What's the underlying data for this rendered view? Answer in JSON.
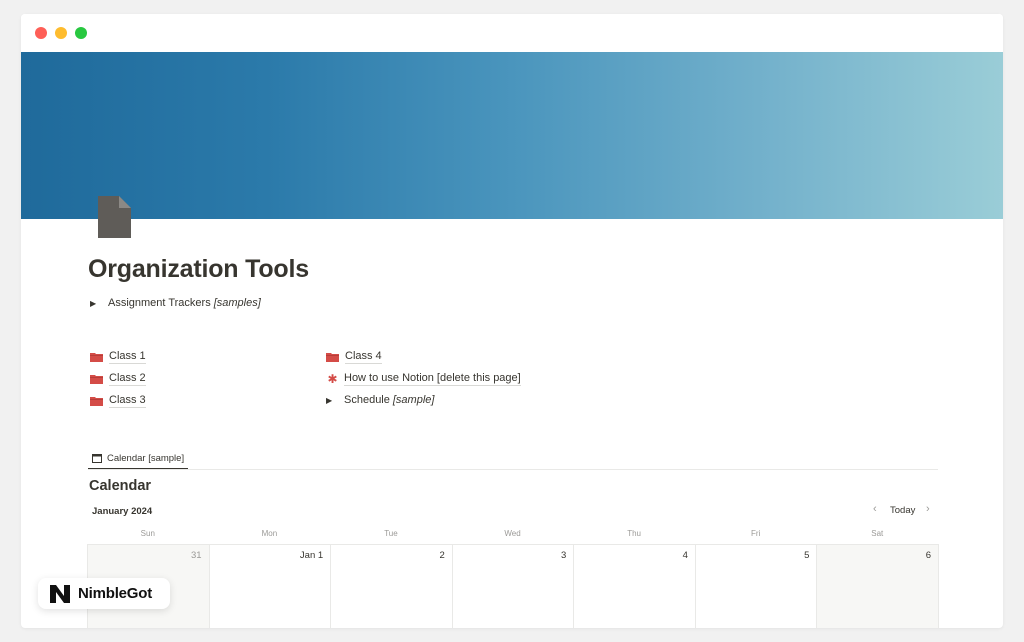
{
  "page": {
    "title": "Organization Tools",
    "assignment_toggle": {
      "label": "Assignment Trackers",
      "italic": "[samples]"
    }
  },
  "links": {
    "left": [
      {
        "label": "Class 1",
        "icon": "folder-icon"
      },
      {
        "label": "Class 2",
        "icon": "folder-icon"
      },
      {
        "label": "Class 3",
        "icon": "folder-icon"
      }
    ],
    "right": [
      {
        "label": "Class 4",
        "icon": "folder-icon"
      },
      {
        "label": "How to use Notion [delete this page]",
        "icon": "asterisk-icon"
      },
      {
        "label": "Schedule",
        "italic": "[sample]",
        "icon": "toggle-arrow"
      }
    ]
  },
  "view_tab": {
    "label": "Calendar [sample]"
  },
  "calendar": {
    "title": "Calendar",
    "month": "January 2024",
    "today_label": "Today",
    "weekdays": [
      "Sun",
      "Mon",
      "Tue",
      "Wed",
      "Thu",
      "Fri",
      "Sat"
    ],
    "days": [
      "31",
      "Jan 1",
      "2",
      "3",
      "4",
      "5",
      "6"
    ]
  },
  "badge": {
    "text": "NimbleGot"
  },
  "colors": {
    "accent_red": "#d44c47",
    "text": "#37352f",
    "muted": "#9b9a97",
    "cover_start": "#1f6a9b",
    "cover_end": "#9acdd7"
  }
}
